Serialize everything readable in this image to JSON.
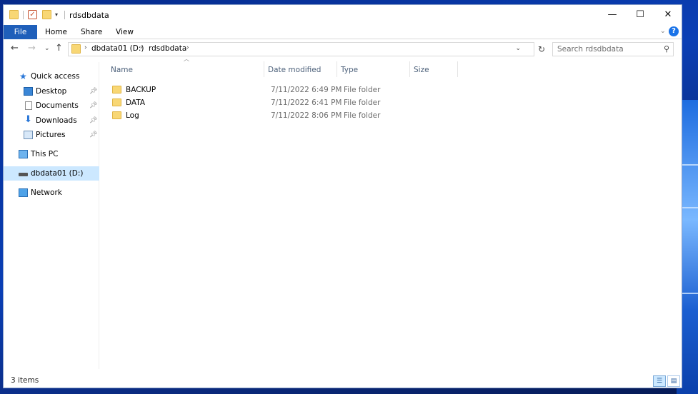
{
  "window": {
    "title": "rdsdbdata"
  },
  "ribbon": {
    "tabs": [
      "File",
      "Home",
      "Share",
      "View"
    ]
  },
  "address": {
    "breadcrumbs": [
      "dbdata01 (D:)",
      "rdsdbdata"
    ],
    "search_placeholder": "Search rdsdbdata"
  },
  "sidebar": {
    "quick_access": "Quick access",
    "items": [
      {
        "label": "Desktop",
        "icon": "desktop-icon"
      },
      {
        "label": "Documents",
        "icon": "documents-icon"
      },
      {
        "label": "Downloads",
        "icon": "downloads-icon"
      },
      {
        "label": "Pictures",
        "icon": "pictures-icon"
      }
    ],
    "this_pc": "This PC",
    "drive": "dbdata01 (D:)",
    "network": "Network"
  },
  "columns": [
    "Name",
    "Date modified",
    "Type",
    "Size"
  ],
  "files": [
    {
      "name": "BACKUP",
      "date": "7/11/2022 6:49 PM",
      "type": "File folder"
    },
    {
      "name": "DATA",
      "date": "7/11/2022 6:41 PM",
      "type": "File folder"
    },
    {
      "name": "Log",
      "date": "7/11/2022 8:06 PM",
      "type": "File folder"
    }
  ],
  "status": {
    "item_count": "3 items"
  }
}
